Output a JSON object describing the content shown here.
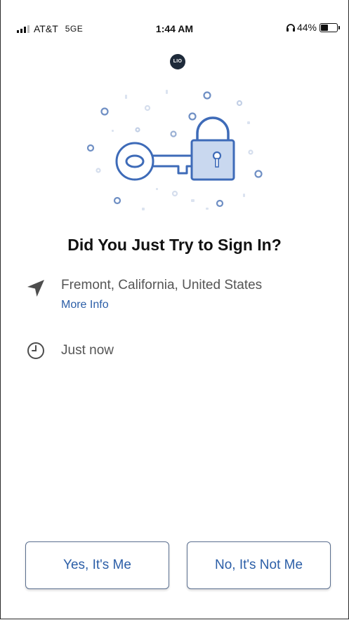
{
  "status_bar": {
    "carrier": "AT&T",
    "network": "5GE",
    "time": "1:44 AM",
    "battery": "44%",
    "battery_level": 0.44
  },
  "logo": {
    "text": "LIO"
  },
  "title": "Did You Just Try to Sign In?",
  "location": {
    "text": "Fremont, California, United States",
    "more_info": "More Info",
    "icon": "location-arrow-icon"
  },
  "time_info": {
    "text": "Just now",
    "icon": "clock-icon"
  },
  "buttons": {
    "yes": "Yes, It's Me",
    "no": "No, It's Not Me"
  },
  "colors": {
    "accent": "#2b5ea7",
    "illustration_blue": "#3e6bb8",
    "lock_fill": "#c9d8ef",
    "button_border": "#5b6f8f"
  }
}
